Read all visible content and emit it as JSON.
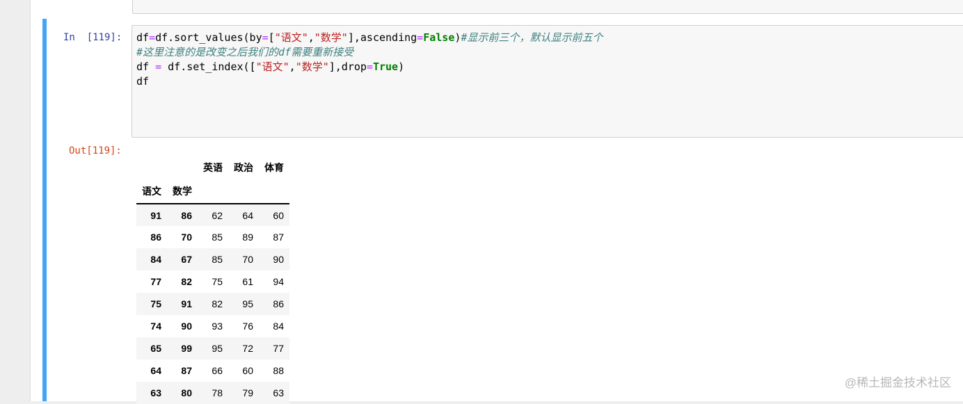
{
  "cell": {
    "in_prompt": "In  [119]:",
    "out_prompt": "Out[119]:",
    "code_lines": [
      [
        {
          "t": "df",
          "c": ""
        },
        {
          "t": "=",
          "c": "c-op"
        },
        {
          "t": "df.sort_values(by",
          "c": ""
        },
        {
          "t": "=",
          "c": "c-op"
        },
        {
          "t": "[",
          "c": ""
        },
        {
          "t": "\"语文\"",
          "c": "c-str"
        },
        {
          "t": ",",
          "c": ""
        },
        {
          "t": "\"数学\"",
          "c": "c-str"
        },
        {
          "t": "],ascending",
          "c": ""
        },
        {
          "t": "=",
          "c": "c-op"
        },
        {
          "t": "False",
          "c": "c-kw"
        },
        {
          "t": ")",
          "c": ""
        },
        {
          "t": "#显示前三个，默认显示前五个",
          "c": "c-cm"
        }
      ],
      [
        {
          "t": "#这里注意的是改变之后我们的df需要重新接受",
          "c": "c-cm"
        }
      ],
      [
        {
          "t": "df ",
          "c": ""
        },
        {
          "t": "=",
          "c": "c-op"
        },
        {
          "t": " df.set_index([",
          "c": ""
        },
        {
          "t": "\"语文\"",
          "c": "c-str"
        },
        {
          "t": ",",
          "c": ""
        },
        {
          "t": "\"数学\"",
          "c": "c-str"
        },
        {
          "t": "],drop",
          "c": ""
        },
        {
          "t": "=",
          "c": "c-op"
        },
        {
          "t": "True",
          "c": "c-kw"
        },
        {
          "t": ")",
          "c": ""
        }
      ],
      [
        {
          "t": "df",
          "c": ""
        }
      ]
    ]
  },
  "dataframe": {
    "columns": [
      "英语",
      "政治",
      "体育"
    ],
    "index_names": [
      "语文",
      "数学"
    ],
    "rows": [
      {
        "index": [
          "91",
          "86"
        ],
        "values": [
          "62",
          "64",
          "60"
        ]
      },
      {
        "index": [
          "86",
          "70"
        ],
        "values": [
          "85",
          "89",
          "87"
        ]
      },
      {
        "index": [
          "84",
          "67"
        ],
        "values": [
          "85",
          "70",
          "90"
        ]
      },
      {
        "index": [
          "77",
          "82"
        ],
        "values": [
          "75",
          "61",
          "94"
        ]
      },
      {
        "index": [
          "75",
          "91"
        ],
        "values": [
          "82",
          "95",
          "86"
        ]
      },
      {
        "index": [
          "74",
          "90"
        ],
        "values": [
          "93",
          "76",
          "84"
        ]
      },
      {
        "index": [
          "65",
          "99"
        ],
        "values": [
          "95",
          "72",
          "77"
        ]
      },
      {
        "index": [
          "64",
          "87"
        ],
        "values": [
          "66",
          "60",
          "88"
        ]
      },
      {
        "index": [
          "63",
          "80"
        ],
        "values": [
          "78",
          "79",
          "63"
        ]
      }
    ]
  },
  "watermark": "@稀土掘金技术社区",
  "colors": {
    "cell_selected_bar": "#42a5f5",
    "in_prompt": "#303f9f",
    "out_prompt": "#d84315"
  }
}
